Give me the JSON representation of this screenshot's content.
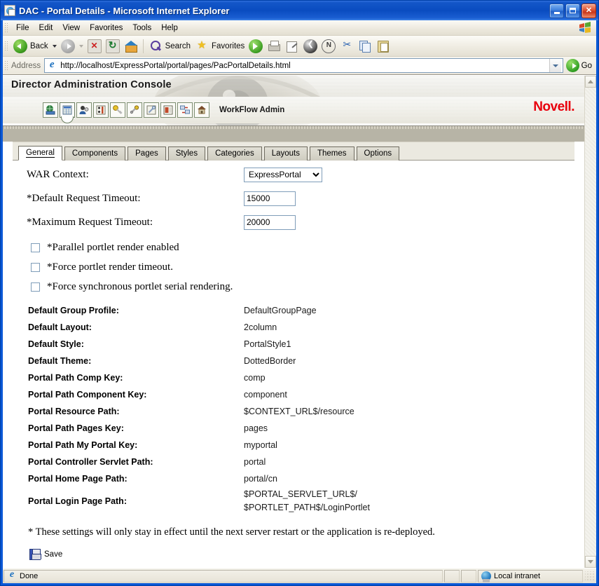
{
  "window": {
    "title": "DAC - Portal Details - Microsoft Internet Explorer",
    "title_icon": "page-icon",
    "minimize_label": "Minimize",
    "maximize_label": "Maximize",
    "close_label": "✕"
  },
  "menubar": {
    "items": [
      {
        "label": "File"
      },
      {
        "label": "Edit"
      },
      {
        "label": "View"
      },
      {
        "label": "Favorites"
      },
      {
        "label": "Tools"
      },
      {
        "label": "Help"
      }
    ]
  },
  "toolbar": {
    "back_label": "Back",
    "forward_label": "",
    "search_label": "Search",
    "favorites_label": "Favorites",
    "icons": [
      "back-icon",
      "forward-icon",
      "stop-icon",
      "refresh-icon",
      "home-icon",
      "search-icon",
      "favorites-star-icon",
      "media-icon",
      "print-icon",
      "edit-icon",
      "messenger-icon",
      "notes-icon",
      "cut-icon",
      "copy-icon",
      "paste-icon"
    ]
  },
  "address": {
    "label": "Address",
    "url": "http://localhost/ExpressPortal/portal/pages/PacPortalDetails.html",
    "go_label": "Go"
  },
  "app": {
    "header_title": "Director Administration Console",
    "module_label": "WorkFlow Admin",
    "brand": "Novell.",
    "brand_color": "#e8000d",
    "toolbar_icons": [
      {
        "name": "portal-globe-icon",
        "selected": false
      },
      {
        "name": "portal-details-grid-icon",
        "selected": true
      },
      {
        "name": "users-icon",
        "selected": false
      },
      {
        "name": "settings-sliders-icon",
        "selected": false
      },
      {
        "name": "key-icon",
        "selected": false
      },
      {
        "name": "tools-icon",
        "selected": false
      },
      {
        "name": "wrench-screen-icon",
        "selected": false
      },
      {
        "name": "layout-icon",
        "selected": false
      },
      {
        "name": "sync-icon",
        "selected": false
      },
      {
        "name": "home-icon",
        "selected": false
      }
    ]
  },
  "tabs": [
    {
      "label": "General",
      "active": true
    },
    {
      "label": "Components",
      "active": false
    },
    {
      "label": "Pages",
      "active": false
    },
    {
      "label": "Styles",
      "active": false
    },
    {
      "label": "Categories",
      "active": false
    },
    {
      "label": "Layouts",
      "active": false
    },
    {
      "label": "Themes",
      "active": false
    },
    {
      "label": "Options",
      "active": false
    }
  ],
  "form": {
    "war_context": {
      "label": "WAR Context:",
      "value": "ExpressPortal",
      "options": [
        "ExpressPortal"
      ]
    },
    "default_request_timeout": {
      "label": "*Default Request Timeout:",
      "value": "15000"
    },
    "maximum_request_timeout": {
      "label": "*Maximum Request Timeout:",
      "value": "20000"
    },
    "checkboxes": [
      {
        "label": "*Parallel portlet render enabled",
        "checked": false
      },
      {
        "label": "*Force portlet render timeout.",
        "checked": false
      },
      {
        "label": "*Force synchronous portlet serial rendering.",
        "checked": false
      }
    ],
    "details": [
      {
        "key": "Default Group Profile:",
        "value": "DefaultGroupPage"
      },
      {
        "key": "Default Layout:",
        "value": "2column"
      },
      {
        "key": "Default Style:",
        "value": "PortalStyle1"
      },
      {
        "key": "Default Theme:",
        "value": "DottedBorder"
      },
      {
        "key": "Portal Path Comp Key:",
        "value": "comp"
      },
      {
        "key": "Portal Path Component Key:",
        "value": "component"
      },
      {
        "key": "Portal Resource Path:",
        "value": "$CONTEXT_URL$/resource"
      },
      {
        "key": "Portal Path Pages Key:",
        "value": "pages"
      },
      {
        "key": "Portal Path My Portal Key:",
        "value": "myportal"
      },
      {
        "key": "Portal Controller Servlet Path:",
        "value": "portal"
      },
      {
        "key": "Portal Home Page Path:",
        "value": "portal/cn"
      },
      {
        "key": "Portal Login Page Path:",
        "value": "$PORTAL_SERVLET_URL$/\n$PORTLET_PATH$/LoginPortlet"
      }
    ],
    "footnote": "*  These settings will only stay in effect until the next server restart or the application is re-deployed.",
    "save_label": "Save"
  },
  "statusbar": {
    "status": "Done",
    "zone": "Local intranet"
  }
}
